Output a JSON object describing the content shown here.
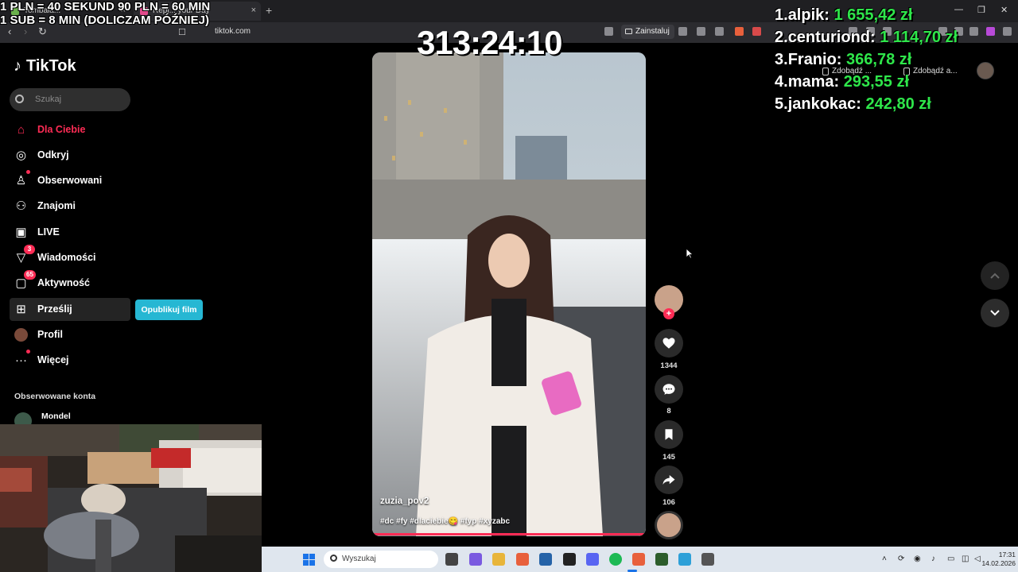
{
  "overlay": {
    "line1": "1 PLN = 40 SEKUND 90 PLN = 60 MIN",
    "line2": "1 SUB = 8 MIN (DOLICZAM PÓŹNIEJ)",
    "timer": "313:24:10"
  },
  "leaderboard": [
    {
      "rank": "1.",
      "name": "alpik:",
      "amount": "1 655,42 zł"
    },
    {
      "rank": "2.",
      "name": "centuriond:",
      "amount": "1 114,70 zł"
    },
    {
      "rank": "3.",
      "name": "Franio:",
      "amount": "366,78 zł"
    },
    {
      "rank": "4.",
      "name": "mama:",
      "amount": "293,55 zł"
    },
    {
      "rank": "5.",
      "name": "jankokac:",
      "amount": "242,80 zł"
    }
  ],
  "browser": {
    "tabs": [
      {
        "title": "Tombala..."
      },
      {
        "title": "Repl... your Day"
      }
    ],
    "url": "tiktok.com",
    "install_label": "Zainstaluj"
  },
  "tiktok": {
    "logo": "TikTok",
    "search_placeholder": "Szukaj",
    "nav": [
      {
        "label": "Dla Ciebie",
        "icon": "home-icon"
      },
      {
        "label": "Odkryj",
        "icon": "compass-icon"
      },
      {
        "label": "Obserwowani",
        "icon": "user-follow-icon"
      },
      {
        "label": "Znajomi",
        "icon": "friends-icon"
      },
      {
        "label": "LIVE",
        "icon": "live-icon"
      },
      {
        "label": "Wiadomości",
        "icon": "inbox-icon",
        "badge": "3"
      },
      {
        "label": "Aktywność",
        "icon": "activity-icon",
        "badge": "65"
      },
      {
        "label": "Prześlij",
        "icon": "upload-icon"
      },
      {
        "label": "Profil",
        "icon": "profile-avatar"
      },
      {
        "label": "Więcej",
        "icon": "more-icon"
      }
    ],
    "publish_label": "Opublikuj film",
    "followed_header": "Obserwowane konta",
    "followed_accounts": [
      "Mondel"
    ],
    "get_app": [
      "Zdobądź ...",
      "Zdobądź a..."
    ]
  },
  "video": {
    "username": "zuzia_pov2",
    "tags": "#dc #fy #dlaciebie😋 #fyp #xyzabc",
    "likes": "1344",
    "comments": "8",
    "saves": "145",
    "shares": "106"
  },
  "taskbar": {
    "search_label": "Wyszukaj",
    "time": "17:31",
    "date": "14.02.2026"
  }
}
